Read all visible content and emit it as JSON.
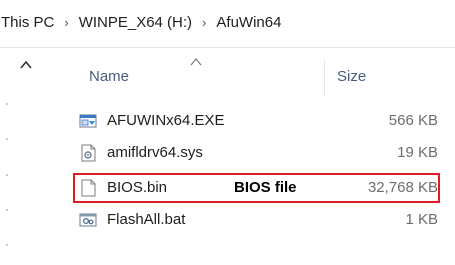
{
  "breadcrumb": {
    "items": [
      "This PC",
      "WINPE_X64 (H:)",
      "AfuWin64"
    ],
    "separator": "›"
  },
  "columns": {
    "name": "Name",
    "size": "Size"
  },
  "files": [
    {
      "name": "AFUWINx64.EXE",
      "size": "566 KB",
      "icon": "exe-icon"
    },
    {
      "name": "amifldrv64.sys",
      "size": "19 KB",
      "icon": "system-file-icon"
    },
    {
      "name": "BIOS.bin",
      "size": "32,768 KB",
      "icon": "blank-file-icon"
    },
    {
      "name": "FlashAll.bat",
      "size": "1 KB",
      "icon": "batch-file-icon"
    }
  ],
  "annotation": {
    "text": "BIOS file",
    "color": "#e01b24"
  },
  "colors": {
    "header_text": "#4a5d7e",
    "size_text": "#6d6d6d"
  }
}
